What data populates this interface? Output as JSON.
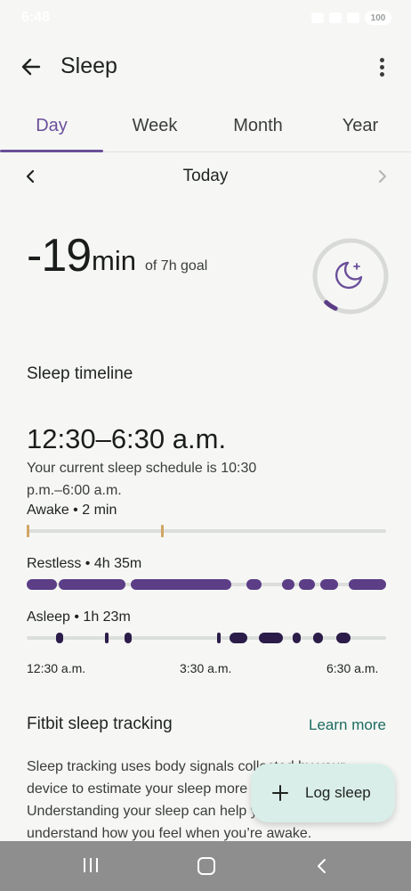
{
  "status": {
    "time": "6:48",
    "battery": "100"
  },
  "header": {
    "title": "Sleep"
  },
  "tabs": [
    {
      "label": "Day",
      "active": true
    },
    {
      "label": "Week",
      "active": false
    },
    {
      "label": "Month",
      "active": false
    },
    {
      "label": "Year",
      "active": false
    }
  ],
  "date_nav": {
    "label": "Today"
  },
  "summary": {
    "delta_value": "-19",
    "delta_unit": "min",
    "goal_text": "of 7h goal",
    "goal_progress": 0.05
  },
  "timeline": {
    "section_title": "Sleep timeline",
    "time_range": "12:30–6:30 a.m.",
    "schedule_text": "Your current sleep schedule is 10:30 p.m.–6:00 a.m.",
    "stages": [
      {
        "name": "awake",
        "label": "Awake • 2 min"
      },
      {
        "name": "restless",
        "label": "Restless • 4h 35m"
      },
      {
        "name": "asleep",
        "label": "Asleep • 1h 23m"
      }
    ],
    "axis_labels": [
      "12:30 a.m.",
      "3:30 a.m.",
      "6:30 a.m."
    ]
  },
  "fitbit": {
    "title": "Fitbit sleep tracking",
    "learn_more": "Learn more",
    "body": "Sleep tracking uses body signals collected by your device to estimate your sleep more accurately. Understanding your sleep can help you better understand how you feel when you’re awake."
  },
  "fab": {
    "label": "Log sleep"
  },
  "colors": {
    "accent": "#6b4f9a",
    "restless": "#5b3e86",
    "asleep": "#2b1c49",
    "awake": "#d2a565",
    "link": "#1d6b5f",
    "fab_bg": "#d9eee8"
  }
}
